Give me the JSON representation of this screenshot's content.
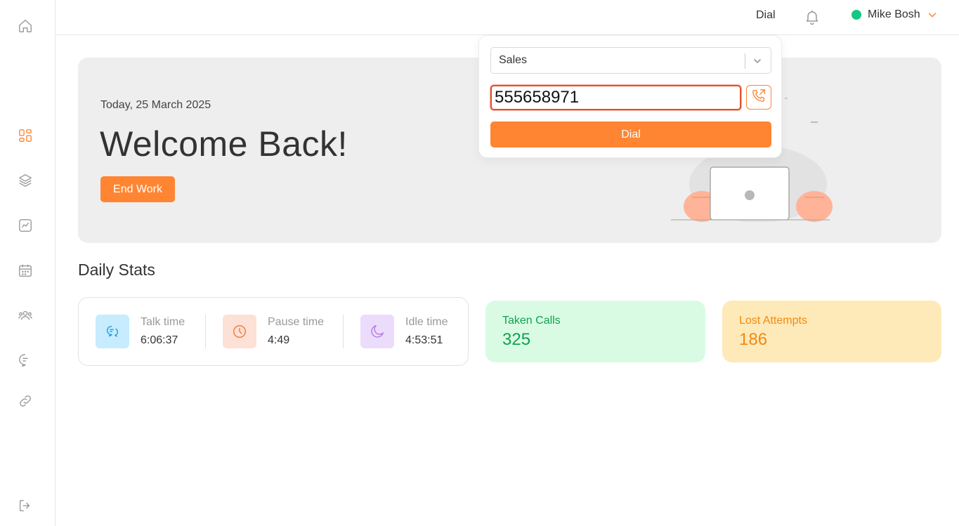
{
  "topbar": {
    "dial_label": "Dial",
    "user_name": "Mike Bosh",
    "user_status_color": "#16c784"
  },
  "sidebar": {
    "icons": [
      "home-icon",
      "dashboard-icon",
      "layers-icon",
      "chart-icon",
      "calendar-icon",
      "users-icon",
      "chat-icon",
      "link-icon",
      "logout-icon"
    ],
    "active": "dashboard-icon",
    "accent": "#ff8533"
  },
  "hero": {
    "date": "Today, 25 March 2025",
    "title": "Welcome Back!",
    "end_work_label": "End Work"
  },
  "dial_popup": {
    "queue_selected": "Sales",
    "number_value": "555658971",
    "dial_button_label": "Dial"
  },
  "daily_stats": {
    "heading": "Daily Stats",
    "items": [
      {
        "label": "Talk time",
        "value": "6:06:37",
        "icon": "chat-bubble-icon",
        "icon_bg": "#c6ecfd",
        "icon_color": "#1a9ee0"
      },
      {
        "label": "Pause time",
        "value": "4:49",
        "icon": "clock-icon",
        "icon_bg": "#fde0d6",
        "icon_color": "#ef7a2f"
      },
      {
        "label": "Idle time",
        "value": "4:53:51",
        "icon": "moon-icon",
        "icon_bg": "#ecdcfb",
        "icon_color": "#b277e6"
      }
    ],
    "taken_calls": {
      "label": "Taken Calls",
      "value": "325",
      "color": "#12a150"
    },
    "lost_attempts": {
      "label": "Lost Attempts",
      "value": "186",
      "color": "#f08a12"
    }
  }
}
